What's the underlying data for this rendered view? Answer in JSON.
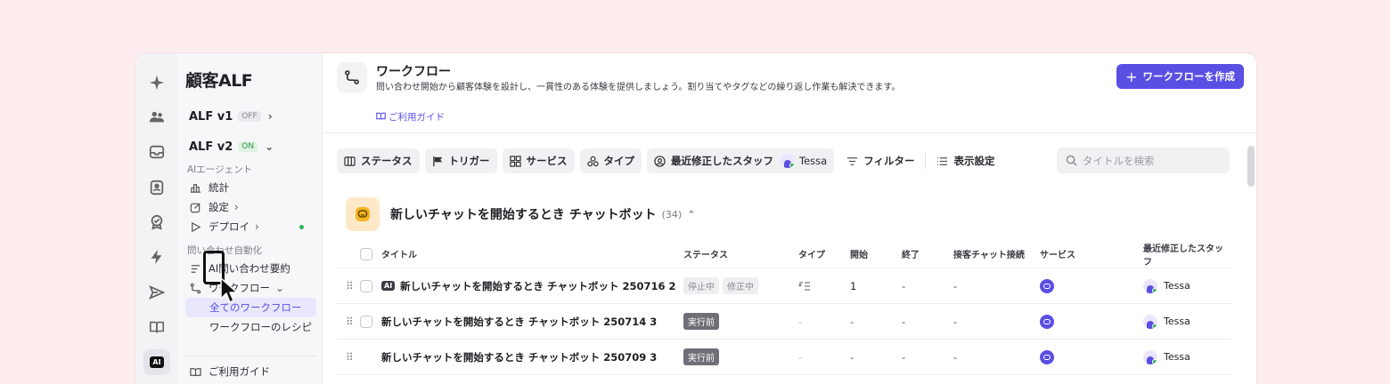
{
  "rail": {
    "icons": [
      "sparkle-icon",
      "users-icon",
      "inbox-icon",
      "contacts-icon",
      "badge-check-icon",
      "bolt-icon",
      "send-icon",
      "book-icon",
      "ai-icon"
    ],
    "ai_label": "AI"
  },
  "nav": {
    "brand": "顧客ALF",
    "v1": {
      "label": "ALF v1",
      "badge": "OFF"
    },
    "v2": {
      "label": "ALF v2",
      "badge": "ON"
    },
    "section_agent": "AIエージェント",
    "stats": "統計",
    "settings": "設定",
    "deploy": "デプロイ",
    "section_auto": "問い合わせ自動化",
    "summary": "AI問い合わせ要約",
    "workflow": "ワークフロー",
    "all_workflows": "全てのワークフロー",
    "recipes": "ワークフローのレシピ",
    "guide": "ご利用ガイド"
  },
  "header": {
    "title": "ワークフロー",
    "description": "問い合わせ開始から顧客体験を設計し、一貫性のある体験を提供しましょう。割り当てやタグなどの繰り返し作業も解決できます。",
    "guide_link": "ご利用ガイド",
    "create_button": "ワークフローを作成"
  },
  "toolbar": {
    "status": "ステータス",
    "trigger": "トリガー",
    "service": "サービス",
    "type": "タイプ",
    "staff": "最近修正したスタッフ",
    "staff_name": "Tessa",
    "filter": "フィルター",
    "display": "表示設定",
    "search_placeholder": "タイトルを検索"
  },
  "group": {
    "title": "新しいチャットを開始するとき チャットボット",
    "count": "(34)"
  },
  "columns": {
    "title": "タイトル",
    "status": "ステータス",
    "type": "タイプ",
    "start": "開始",
    "end": "終了",
    "chat": "接客チャット接続",
    "service": "サービス",
    "staff": "最近修正したスタッフ"
  },
  "rows": [
    {
      "ai": "AI",
      "title": "新しいチャットを開始するとき チャットボット 250716 2",
      "status1": "停止中",
      "status2": "修正中",
      "start": "1",
      "end": "-",
      "chat": "-",
      "staff": "Tessa"
    },
    {
      "title": "新しいチャットを開始するとき チャットボット 250714 3",
      "status1": "実行前",
      "type": "-",
      "start": "-",
      "end": "-",
      "chat": "-",
      "staff": "Tessa"
    },
    {
      "title": "新しいチャットを開始するとき チャットボット 250709 3",
      "status1": "実行前",
      "type": "-",
      "start": "-",
      "end": "-",
      "chat": "-",
      "staff": "Tessa"
    }
  ],
  "colors": {
    "accent": "#5b4fe3",
    "on": "#2fb45a",
    "bg": "#fdecee"
  }
}
